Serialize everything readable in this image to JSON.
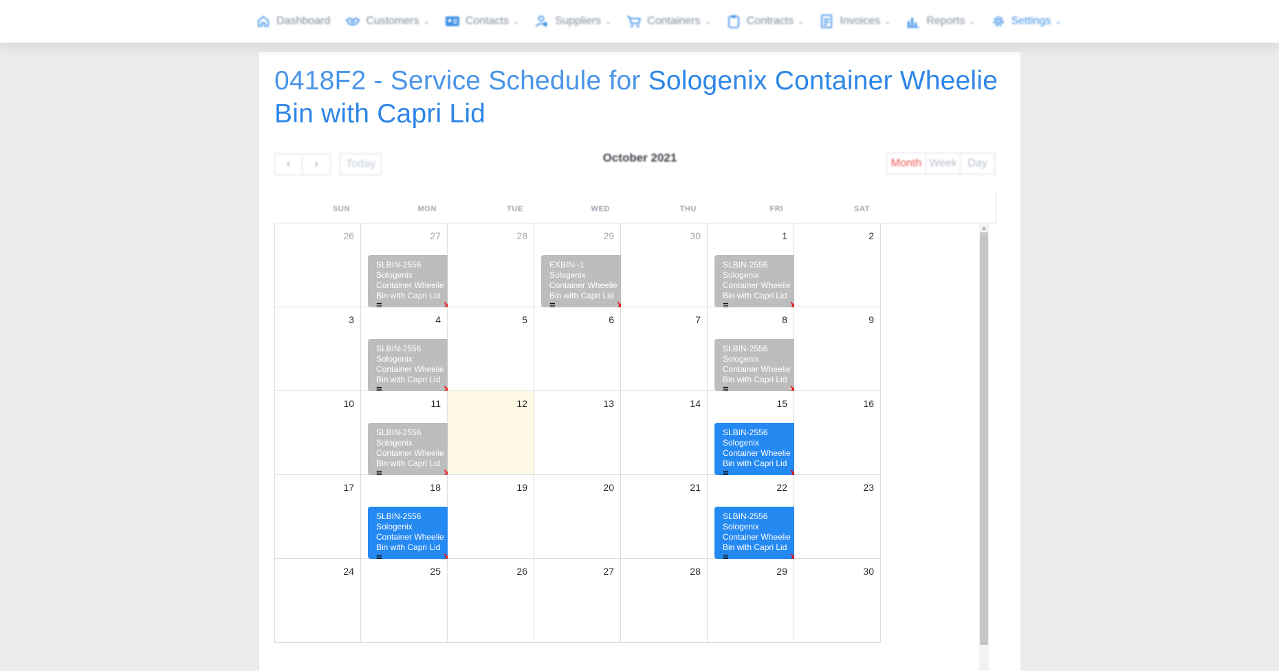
{
  "nav": {
    "items": [
      {
        "label": "Dashboard",
        "icon": "home-icon",
        "active": false,
        "dropdown": false
      },
      {
        "label": "Customers",
        "icon": "handshake-icon",
        "active": false,
        "dropdown": true
      },
      {
        "label": "Contacts",
        "icon": "contact-card-icon",
        "active": false,
        "dropdown": true
      },
      {
        "label": "Suppliers",
        "icon": "supplier-icon",
        "active": false,
        "dropdown": true
      },
      {
        "label": "Containers",
        "icon": "cart-icon",
        "active": false,
        "dropdown": true
      },
      {
        "label": "Contracts",
        "icon": "clipboard-icon",
        "active": false,
        "dropdown": true
      },
      {
        "label": "Invoices",
        "icon": "invoice-icon",
        "active": false,
        "dropdown": true
      },
      {
        "label": "Reports",
        "icon": "bar-chart-icon",
        "active": false,
        "dropdown": true
      },
      {
        "label": "Settings",
        "icon": "gear-icon",
        "active": true,
        "dropdown": true
      }
    ]
  },
  "page": {
    "title_prefix": "0418F2 - Service Schedule for ",
    "title_product": "Sologenix Container Wheelie Bin with Capri Lid"
  },
  "toolbar": {
    "prev_glyph": "‹",
    "next_glyph": "›",
    "today_label": "Today",
    "month_label": "October 2021",
    "views": [
      "Month",
      "Week",
      "Day"
    ],
    "active_view": "Month"
  },
  "calendar": {
    "weekdays": [
      "SUN",
      "MON",
      "TUE",
      "WED",
      "THU",
      "FRI",
      "SAT"
    ],
    "weeks": [
      [
        {
          "day": "26",
          "other": true
        },
        {
          "day": "27",
          "other": true
        },
        {
          "day": "28",
          "other": true
        },
        {
          "day": "29",
          "other": true
        },
        {
          "day": "30",
          "other": true
        },
        {
          "day": "1"
        },
        {
          "day": "2"
        }
      ],
      [
        {
          "day": "3"
        },
        {
          "day": "4"
        },
        {
          "day": "5"
        },
        {
          "day": "6"
        },
        {
          "day": "7"
        },
        {
          "day": "8"
        },
        {
          "day": "9"
        }
      ],
      [
        {
          "day": "10"
        },
        {
          "day": "11"
        },
        {
          "day": "12",
          "today": true
        },
        {
          "day": "13"
        },
        {
          "day": "14"
        },
        {
          "day": "15"
        },
        {
          "day": "16"
        }
      ],
      [
        {
          "day": "17"
        },
        {
          "day": "18"
        },
        {
          "day": "19"
        },
        {
          "day": "20"
        },
        {
          "day": "21"
        },
        {
          "day": "22"
        },
        {
          "day": "23"
        }
      ],
      [
        {
          "day": "24"
        },
        {
          "day": "25"
        },
        {
          "day": "26"
        },
        {
          "day": "27"
        },
        {
          "day": "28"
        },
        {
          "day": "29"
        },
        {
          "day": "30"
        }
      ]
    ],
    "events": [
      {
        "week": 0,
        "dow": 1,
        "status": "past",
        "lines": [
          "SLBIN-2556",
          "Sologenix",
          "Container Wheelie",
          "Bin with Capri Lid"
        ]
      },
      {
        "week": 0,
        "dow": 3,
        "status": "past",
        "lines": [
          "EXBIN--1",
          "Sologenix",
          "Container Wheelie",
          "Bin with Capri Lid"
        ]
      },
      {
        "week": 0,
        "dow": 5,
        "status": "past",
        "lines": [
          "SLBIN-2556",
          "Sologenix",
          "Container Wheelie",
          "Bin with Capri Lid"
        ]
      },
      {
        "week": 1,
        "dow": 1,
        "status": "past",
        "lines": [
          "SLBIN-2556",
          "Sologenix",
          "Container Wheelie",
          "Bin with Capri Lid"
        ]
      },
      {
        "week": 1,
        "dow": 5,
        "status": "past",
        "lines": [
          "SLBIN-2556",
          "Sologenix",
          "Container Wheelie",
          "Bin with Capri Lid"
        ]
      },
      {
        "week": 2,
        "dow": 1,
        "status": "past",
        "lines": [
          "SLBIN-2556",
          "Sologenix",
          "Container Wheelie",
          "Bin with Capri Lid"
        ]
      },
      {
        "week": 2,
        "dow": 5,
        "status": "upcoming",
        "lines": [
          "SLBIN-2556",
          "Sologenix",
          "Container Wheelie",
          "Bin with Capri Lid"
        ]
      },
      {
        "week": 3,
        "dow": 1,
        "status": "upcoming",
        "lines": [
          "SLBIN-2556",
          "Sologenix",
          "Container Wheelie",
          "Bin with Capri Lid"
        ]
      },
      {
        "week": 3,
        "dow": 5,
        "status": "upcoming",
        "lines": [
          "SLBIN-2556",
          "Sologenix",
          "Container Wheelie",
          "Bin with Capri Lid"
        ]
      }
    ],
    "event_menu_glyph": "≡",
    "event_delete_glyph": "X"
  },
  "colors": {
    "accent": "#3a8ee6",
    "event_past": "#bdbdbd",
    "event_upcoming": "#2589f2",
    "today_bg": "#fcf8e3",
    "delete": "#ee1010",
    "active_view": "#f05454"
  }
}
